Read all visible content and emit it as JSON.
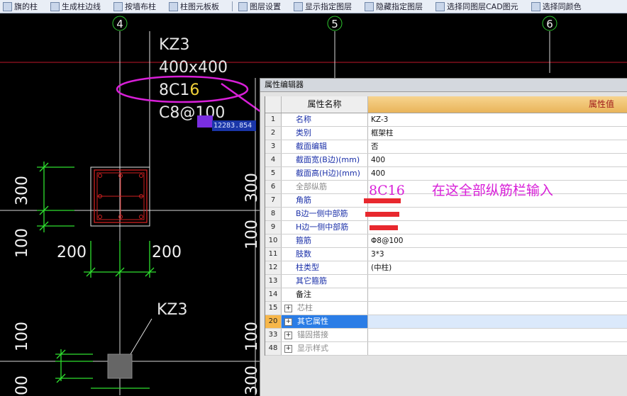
{
  "toolbar": {
    "items": [
      "旗的柱",
      "生成柱边线",
      "按墙布柱",
      "柱图元板板",
      "图层设置",
      "显示指定图层",
      "隐藏指定图层",
      "选择同图层CAD图元",
      "选择同颜色"
    ]
  },
  "drawing": {
    "axes": [
      "4",
      "5",
      "6"
    ],
    "column_label": {
      "name": "KZ3",
      "size": "400x400",
      "rebar_prefix": "8C1",
      "rebar_suffix": "6",
      "stirrup_prefix": "C8@",
      "stirrup_highlight": "100"
    },
    "coordinate_readout": "12283.854",
    "dims": {
      "left_300": "300",
      "left_100": "100",
      "bottom_200_left": "200",
      "bottom_200_right": "200",
      "left_100_lower": "100",
      "left_00_bottom": "00",
      "mid_300": "300",
      "mid_100": "100",
      "mid_100_lower": "100",
      "mid_300_lower": "300"
    },
    "second_label": "KZ3"
  },
  "annotation": {
    "value": "8C16",
    "text": "在这全部纵筋栏输入"
  },
  "property_editor": {
    "title": "属性编辑器",
    "header_name": "属性名称",
    "header_value": "属性值",
    "rows": [
      {
        "n": "1",
        "name": "名称",
        "value": "KZ-3"
      },
      {
        "n": "2",
        "name": "类别",
        "value": "框架柱"
      },
      {
        "n": "3",
        "name": "截面编辑",
        "value": "否"
      },
      {
        "n": "4",
        "name": "截面宽(B边)(mm)",
        "value": "400"
      },
      {
        "n": "5",
        "name": "截面高(H边)(mm)",
        "value": "400"
      },
      {
        "n": "6",
        "name": "全部纵筋",
        "value": ""
      },
      {
        "n": "7",
        "name": "角筋",
        "value": ""
      },
      {
        "n": "8",
        "name": "B边一侧中部筋",
        "value": ""
      },
      {
        "n": "9",
        "name": "H边一侧中部筋",
        "value": ""
      },
      {
        "n": "10",
        "name": "箍筋",
        "value": "Φ8@100"
      },
      {
        "n": "11",
        "name": "肢数",
        "value": "3*3"
      },
      {
        "n": "12",
        "name": "柱类型",
        "value": "(中柱)"
      },
      {
        "n": "13",
        "name": "其它箍筋",
        "value": ""
      },
      {
        "n": "14",
        "name": "备注",
        "value": ""
      },
      {
        "n": "15",
        "name": "芯柱",
        "value": ""
      },
      {
        "n": "20",
        "name": "其它属性",
        "value": ""
      },
      {
        "n": "33",
        "name": "锚固搭接",
        "value": ""
      },
      {
        "n": "48",
        "name": "显示样式",
        "value": ""
      }
    ]
  },
  "colors": {
    "annotation": "#d81fd8",
    "cad_green": "#2fe02f",
    "axis_red": "#c0182a",
    "selected_row": "#2b7de6"
  }
}
